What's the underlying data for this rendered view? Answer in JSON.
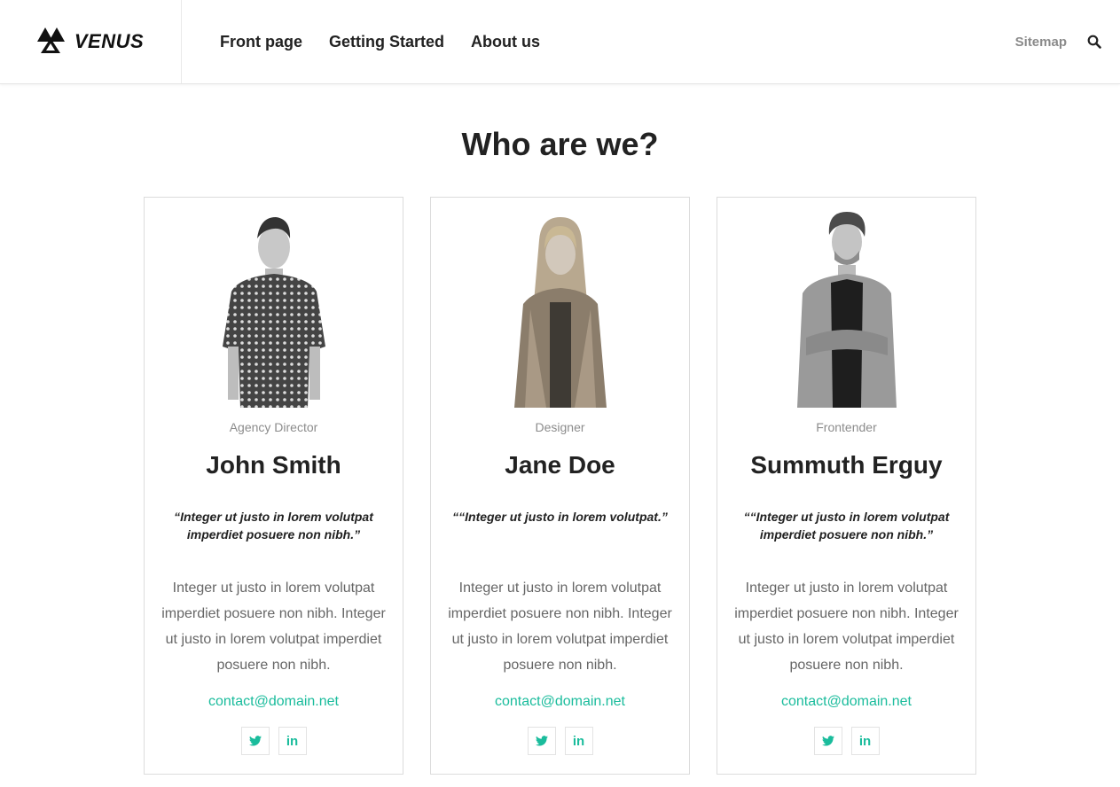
{
  "header": {
    "brand": "VENUS",
    "nav": [
      "Front page",
      "Getting Started",
      "About us"
    ],
    "sitemap": "Sitemap"
  },
  "page_title": "Who are we?",
  "colors": {
    "accent": "#1abc9c",
    "text": "#222222",
    "muted": "#8c8c8c"
  },
  "team": [
    {
      "role": "Agency Director",
      "name": "John Smith",
      "quote": "“Integer ut justo in lorem volutpat imperdiet posuere non nibh.”",
      "description": "Integer ut justo in lorem volutpat imperdiet posuere non nibh. Integer ut justo in lorem volutpat imperdiet posuere non nibh.",
      "email": "contact@domain.net",
      "socials": [
        "twitter-icon",
        "linkedin-icon"
      ]
    },
    {
      "role": "Designer",
      "name": "Jane Doe",
      "quote": "““Integer ut justo in lorem volutpat.”",
      "description": "Integer ut justo in lorem volutpat imperdiet posuere non nibh. Integer ut justo in lorem volutpat imperdiet posuere non nibh.",
      "email": "contact@domain.net",
      "socials": [
        "twitter-icon",
        "linkedin-icon"
      ]
    },
    {
      "role": "Frontender",
      "name": "Summuth Erguy",
      "quote": "““Integer ut justo in lorem volutpat imperdiet posuere non nibh.”",
      "description": "Integer ut justo in lorem volutpat imperdiet posuere non nibh. Integer ut justo in lorem volutpat imperdiet posuere non nibh.",
      "email": "contact@domain.net",
      "socials": [
        "twitter-icon",
        "linkedin-icon"
      ]
    }
  ]
}
